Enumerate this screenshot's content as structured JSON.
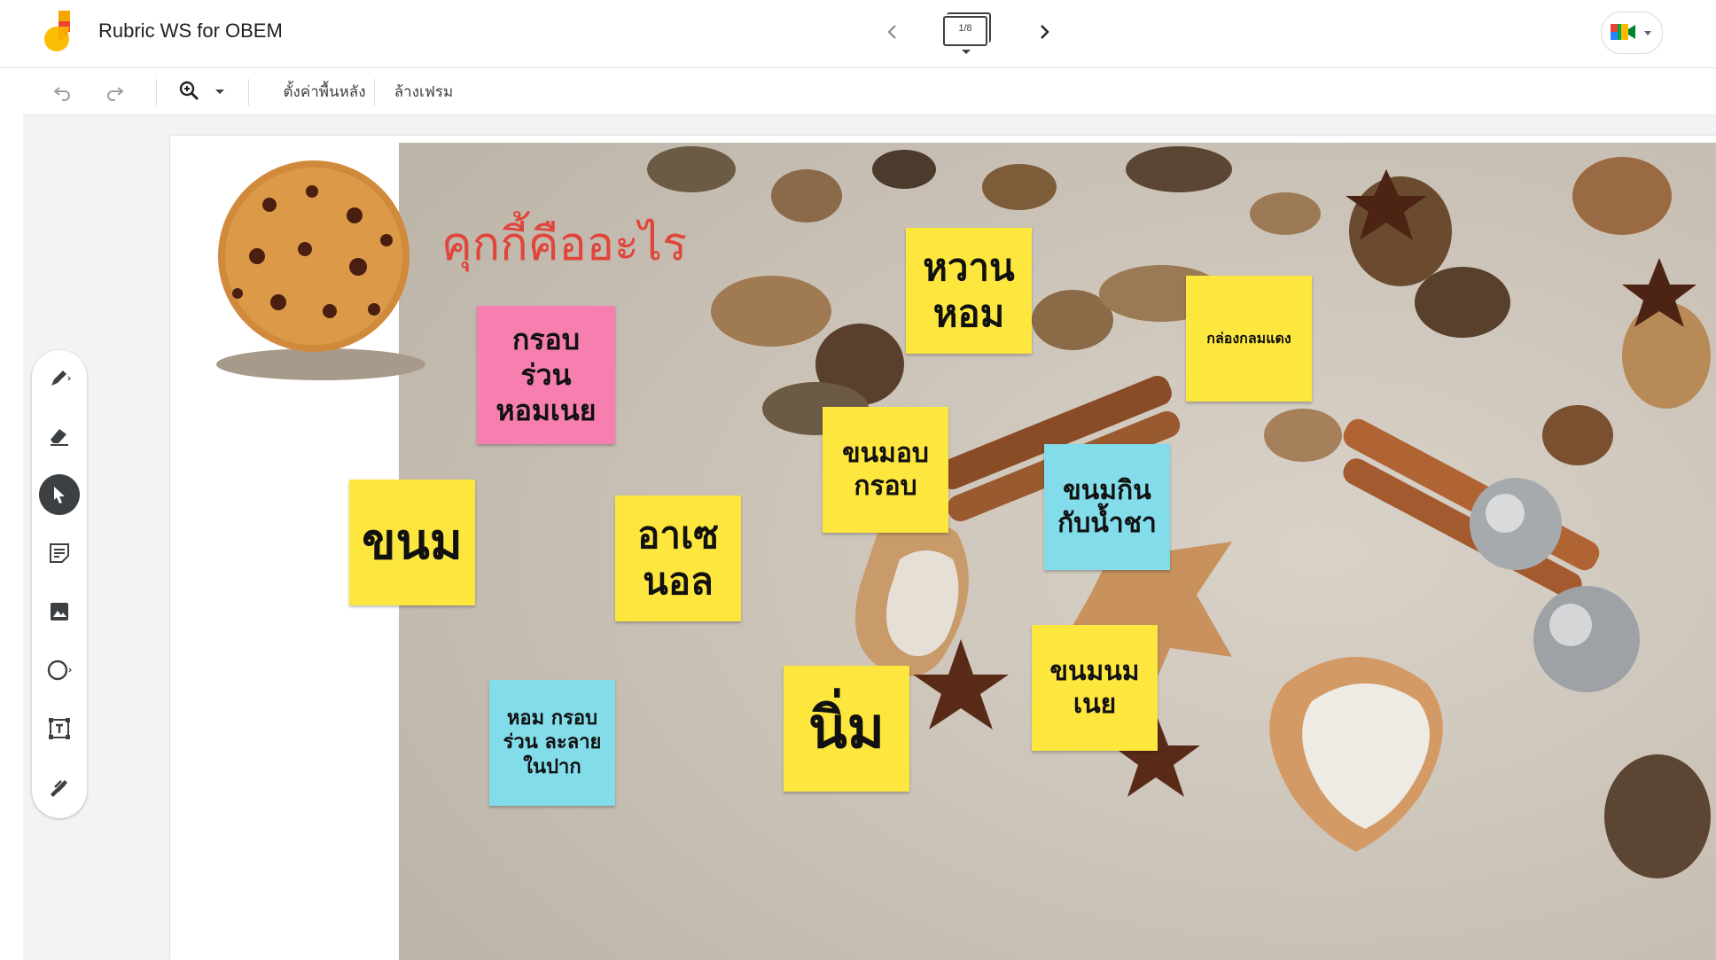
{
  "app": {
    "title": "Rubric WS for OBEM",
    "frame_indicator": "1/8"
  },
  "toolbar": {
    "set_background_label": "ตั้งค่าพื้นหลัง",
    "clear_frame_label": "ล้างเฟรม"
  },
  "board": {
    "title": "คุกกี้คืออะไร",
    "notes": [
      {
        "text": "กรอบ\nร่วน\nหอมเนย",
        "color": "#f77fb0"
      },
      {
        "text": "หวาน\nหอม",
        "color": "#fde73e"
      },
      {
        "text": "กล่องกลมแดง",
        "color": "#fde73e"
      },
      {
        "text": "ขนมอบ\nกรอบ",
        "color": "#fde73e"
      },
      {
        "text": "ขนมกิน\nกับน้ำชา",
        "color": "#82dcea"
      },
      {
        "text": "ขนม",
        "color": "#fde73e"
      },
      {
        "text": "อาเซ\nนอล",
        "color": "#fde73e"
      },
      {
        "text": "ขนมนม\nเนย",
        "color": "#fde73e"
      },
      {
        "text": "หอม กรอบ\nร่วน ละลาย\nในปาก",
        "color": "#82dcea"
      },
      {
        "text": "นิ่ม",
        "color": "#fde73e"
      }
    ]
  },
  "colors": {
    "title_red": "#e0453c",
    "accent_orange": "#f7a600",
    "accent_yellow": "#fbbc04"
  },
  "icons": {
    "logo": "jamboard-logo",
    "undo": "undo-icon",
    "redo": "redo-icon",
    "zoom": "zoom-in-icon",
    "tools": [
      "pen-icon",
      "eraser-icon",
      "select-icon",
      "sticky-note-icon",
      "image-icon",
      "circle-icon",
      "text-box-icon",
      "laser-icon"
    ]
  }
}
